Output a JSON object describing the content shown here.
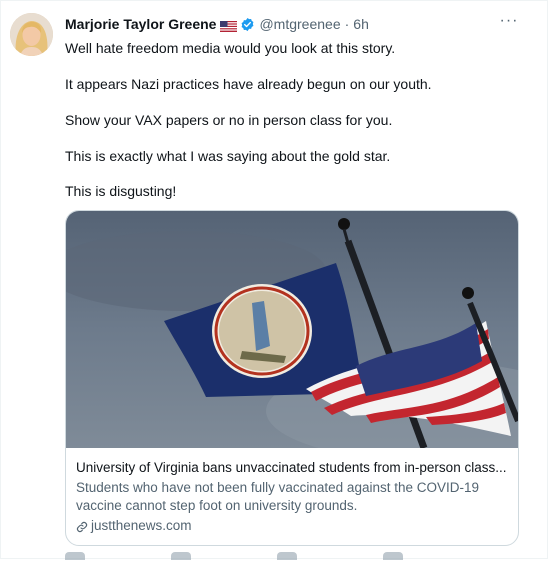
{
  "tweet": {
    "author_name": "Marjorie Taylor Greene",
    "handle": "@mtgreenee",
    "separator": "·",
    "time": "6h",
    "more_label": "···",
    "paragraphs": [
      "Well hate freedom media would you look at this story.",
      "It appears Nazi practices have already begun on our youth.",
      "Show your VAX papers or no in person class for you.",
      "This is exactly what I was saying about the gold star.",
      "This is disgusting!"
    ]
  },
  "card": {
    "title": "University of Virginia bans unvaccinated students from in-person class...",
    "description": "Students who have not been fully vaccinated against the COVID-19 vaccine cannot step foot on university grounds.",
    "domain": "justthenews.com"
  },
  "colors": {
    "verified": "#1d9bf0",
    "muted_text": "#536471",
    "border": "#cfd9de"
  },
  "icons": [
    "verified-badge-icon",
    "us-flag-icon",
    "more-options-icon",
    "link-icon"
  ]
}
